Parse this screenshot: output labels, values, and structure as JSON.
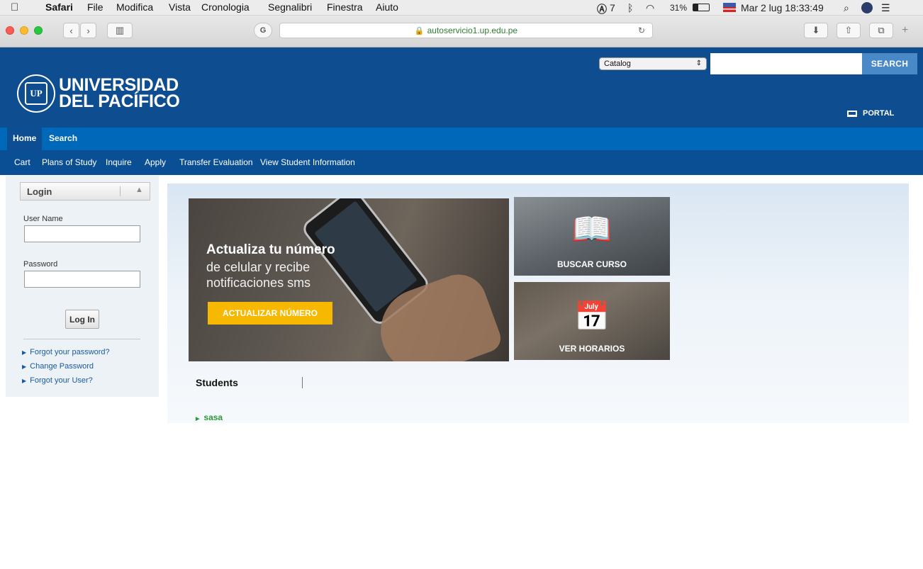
{
  "menubar": {
    "apple": "",
    "app": "Safari",
    "menus": [
      "File",
      "Modifica",
      "Vista",
      "Cronologia",
      "Segnalibri",
      "Finestra",
      "Aiuto"
    ],
    "status": {
      "adobe": "7",
      "battery": "31%",
      "clock": "Mar 2 lug 18:33:49"
    }
  },
  "browser": {
    "url": "autoservicio1.up.edu.pe"
  },
  "header": {
    "logo_line1": "UNIVERSIDAD",
    "logo_line2": "DEL PACÍFICO",
    "catalog_select": "Catalog",
    "search_button": "SEARCH",
    "portal_link": "PORTAL"
  },
  "nav": {
    "primary": [
      "Home",
      "Search"
    ],
    "secondary": [
      "Cart",
      "Plans of Study",
      "Inquire",
      "Apply",
      "Transfer Evaluation",
      "View Student Information"
    ]
  },
  "login": {
    "title": "Login",
    "username_label": "User Name",
    "password_label": "Password",
    "button": "Log In",
    "links": [
      "Forgot your password?",
      "Change Password",
      "Forgot your User?"
    ]
  },
  "banner": {
    "title": "Actualiza tu número",
    "subtitle": "de celular y recibe notificaciones sms",
    "cta": "ACTUALIZAR NÚMERO"
  },
  "tiles": {
    "buscar": "BUSCAR CURSO",
    "horarios": "VER HORARIOS"
  },
  "students": {
    "heading": "Students",
    "items": [
      "sasa"
    ]
  },
  "colors": {
    "header_blue": "#0e4d8f",
    "nav_blue": "#0068b8",
    "cta_yellow": "#f6b800",
    "link_green": "#2b9a36"
  }
}
